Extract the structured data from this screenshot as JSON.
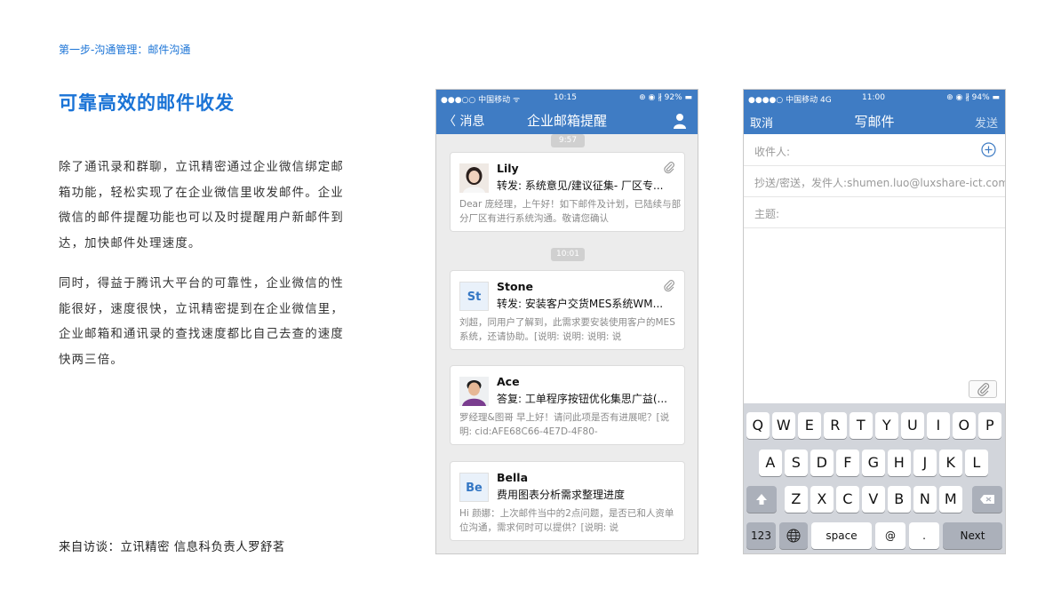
{
  "slide": {
    "step_label": "第一步-沟通管理：邮件沟通",
    "headline": "可靠高效的邮件收发",
    "paragraph1": "除了通讯录和群聊，立讯精密通过企业微信绑定邮箱功能，轻松实现了在企业微信里收发邮件。企业微信的邮件提醒功能也可以及时提醒用户新邮件到达，加快邮件处理速度。",
    "paragraph2": "同时，得益于腾讯大平台的可靠性，企业微信的性能很好，速度很快，立讯精密提到在企业微信里，企业邮箱和通讯录的查找速度都比自己去查的速度快两三倍。",
    "source": "来自访谈：立讯精密 信息科负责人罗舒茗"
  },
  "phone1": {
    "status": {
      "carrier": "●●●○○ 中国移动 ᯤ",
      "time": "10:15",
      "battery": "⊕ ◉ ∦ 92% ▬"
    },
    "nav": {
      "back_label": "〈 消息",
      "title": "企业邮箱提醒"
    },
    "time_pill_top": "9:57",
    "time_pill_mid": "10:01",
    "mails": [
      {
        "sender": "Lily",
        "subject": "转发: 系统意见/建议征集- 厂区专...",
        "preview": "Dear 庞经理，上午好！如下邮件及计划，已陆续与部分厂区有进行系统沟通。敬请您确认",
        "avatar": "photo",
        "attachment": true
      },
      {
        "sender": "Stone",
        "subject": "转发: 安装客户交货MES系统WM...",
        "preview": "刘超，同用户了解到，此需求要安装使用客户的MES系统，还请协助。[说明: 说明: 说明: 说",
        "avatar": "St",
        "attachment": true
      },
      {
        "sender": "Ace",
        "subject": "答复: 工单程序按钮优化集思广益(...",
        "preview": "罗经理&图哥 早上好！请问此项是否有进展呢？[说明: cid:AFE68C66-4E7D-4F80-",
        "avatar": "photo",
        "attachment": false
      },
      {
        "sender": "Bella",
        "subject": "费用图表分析需求整理进度",
        "preview": "Hi 颜娜：上次邮件当中的2点问题，是否已和人资单位沟通，需求何时可以提供？[说明: 说",
        "avatar": "Be",
        "attachment": false
      }
    ]
  },
  "phone2": {
    "status": {
      "carrier": "●●●●○ 中国移动 4G",
      "time": "11:00",
      "battery": "⊕ ◉ ∦ 94% ▬"
    },
    "nav": {
      "cancel_label": "取消",
      "title": "写邮件",
      "send_label": "发送"
    },
    "fields": {
      "to": "收件人:",
      "cc": "抄送/密送，发件人:shumen.luo@luxshare-ict.com",
      "subject": "主题:"
    },
    "keyboard": {
      "row1": [
        "Q",
        "W",
        "E",
        "R",
        "T",
        "Y",
        "U",
        "I",
        "O",
        "P"
      ],
      "row2": [
        "A",
        "S",
        "D",
        "F",
        "G",
        "H",
        "J",
        "K",
        "L"
      ],
      "row3": [
        "Z",
        "X",
        "C",
        "V",
        "B",
        "N",
        "M"
      ],
      "bottom": {
        "numbers": "123",
        "space": "space",
        "at": "@",
        "dot": ".",
        "next": "Next"
      }
    }
  },
  "colors": {
    "accent": "#1a73d6",
    "nav": "#3f7cc4"
  }
}
